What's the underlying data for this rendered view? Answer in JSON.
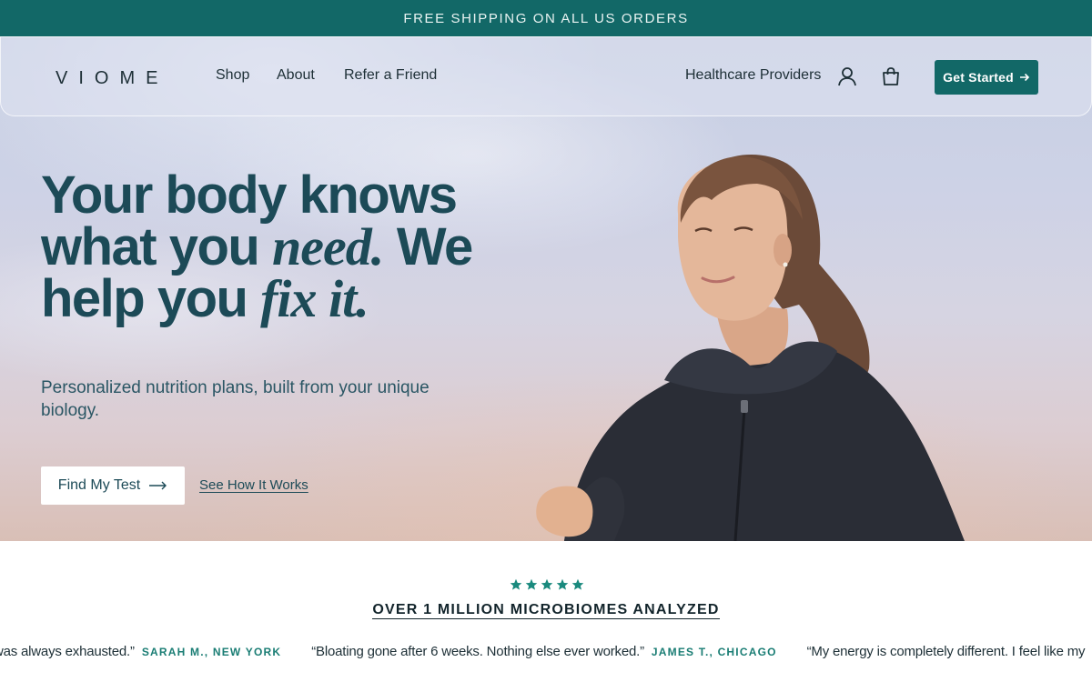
{
  "announcement": {
    "text": "FREE SHIPPING ON ALL US ORDERS"
  },
  "header": {
    "logo_text": "VIOME",
    "nav": [
      {
        "label": "Shop"
      },
      {
        "label": "About"
      },
      {
        "label": "Refer a Friend"
      }
    ],
    "providers_label": "Healthcare Providers",
    "account_icon": "user-icon",
    "cart_icon": "shopping-bag-icon",
    "cta_label": "Get Started",
    "cta_icon": "arrow-right-icon"
  },
  "hero": {
    "headline": {
      "part1": "Your body knows what you ",
      "em1": "need.",
      "part2": " We help you ",
      "em2": "fix it."
    },
    "subheadline": "Personalized nutrition plans, built from your unique biology.",
    "primary_button": "Find My Test",
    "secondary_link": "See How It Works"
  },
  "social_proof": {
    "rating_stars": 5,
    "title": "OVER 1 MILLION MICROBIOMES ANALYZED",
    "testimonials": [
      {
        "quote": "why I was always exhausted.”",
        "author": "SARAH M., NEW YORK"
      },
      {
        "quote": "“Bloating gone after 6 weeks. Nothing else ever worked.”",
        "author": "JAMES T., CHICAGO"
      },
      {
        "quote": "“My energy is completely different. I feel like my",
        "author": ""
      }
    ]
  },
  "colors": {
    "brand_teal": "#126867",
    "headline": "#1c4a57",
    "star": "#1a8a7e",
    "author": "#1a7d74"
  }
}
